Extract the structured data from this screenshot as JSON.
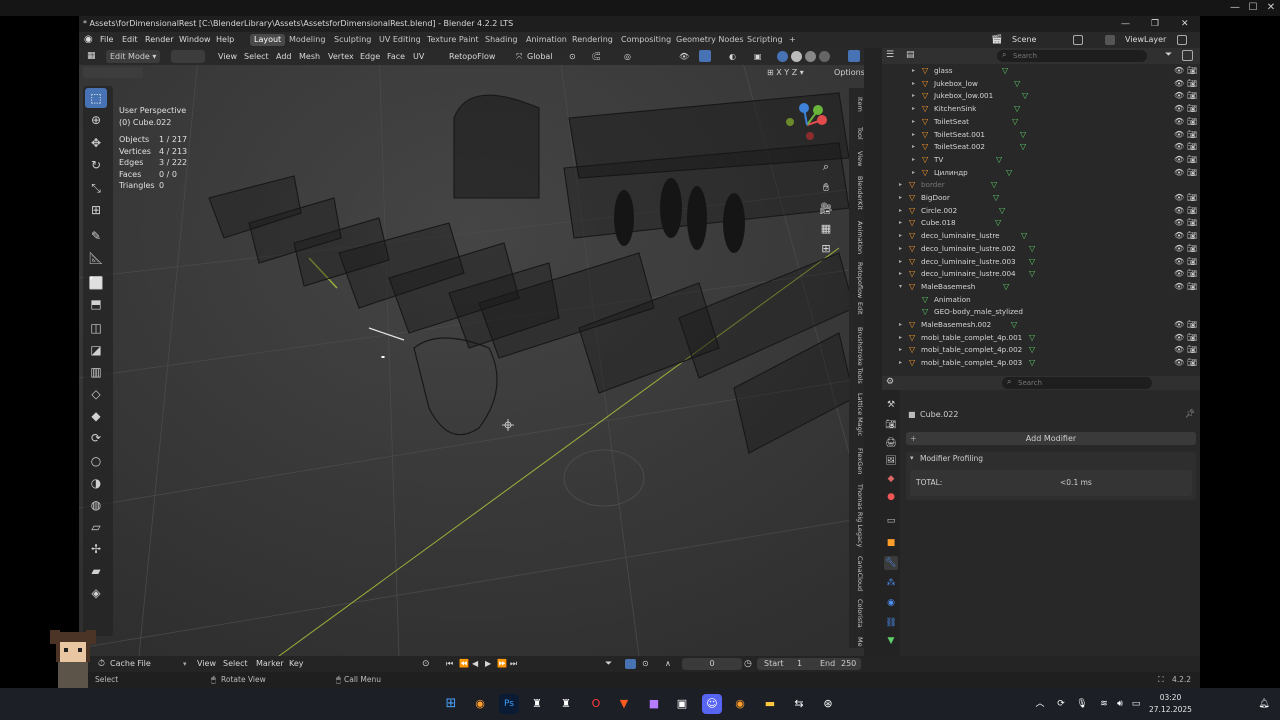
{
  "window": {
    "title": "* Assets\\forDimensionalRest [C:\\BlenderLibrary\\Assets\\AssetsforDimensionalRest.blend] - Blender 4.2.2 LTS"
  },
  "menus": [
    "File",
    "Edit",
    "Render",
    "Window",
    "Help"
  ],
  "workspaces": [
    {
      "label": "Layout",
      "active": true
    },
    {
      "label": "Modeling"
    },
    {
      "label": "Sculpting"
    },
    {
      "label": "UV Editing"
    },
    {
      "label": "Texture Paint"
    },
    {
      "label": "Shading"
    },
    {
      "label": "Animation"
    },
    {
      "label": "Rendering"
    },
    {
      "label": "Compositing"
    },
    {
      "label": "Geometry Nodes"
    },
    {
      "label": "Scripting"
    }
  ],
  "add_workspace": "+",
  "scene": {
    "icon": "scene-icon",
    "name": "Scene",
    "view_layer": "ViewLayer"
  },
  "viewport_header": {
    "mode": "Edit Mode",
    "menus": [
      "View",
      "Select",
      "Add",
      "Mesh",
      "Vertex",
      "Edge",
      "Face",
      "UV"
    ],
    "addon": "RetopoFlow",
    "orientation": "Global",
    "options": "Options"
  },
  "viewport": {
    "view_name": "User Perspective",
    "object": "(0) Cube.022",
    "stats": [
      {
        "label": "Objects",
        "value": "1 / 217"
      },
      {
        "label": "Vertices",
        "value": "4 / 213"
      },
      {
        "label": "Edges",
        "value": "3 / 222"
      },
      {
        "label": "Faces",
        "value": "0 / 0"
      },
      {
        "label": "Triangles",
        "value": "0"
      }
    ],
    "side_tabs": [
      "Item",
      "Tool",
      "View",
      "BlenderKit",
      "Animation",
      "Retopoflow",
      "Edit",
      "Brushstroke Tools",
      "Lattice Magic",
      "FlexGen",
      "Thomas Rig Legacy",
      "CanaCloud",
      "Colorista",
      "Me"
    ]
  },
  "tools": [
    "select-box-icon",
    "cursor-icon",
    "move-icon",
    "rotate-icon",
    "scale-icon",
    "transform-icon",
    "annotate-icon",
    "measure-icon",
    "add-cube-icon",
    "extrude-icon",
    "inset-icon",
    "bevel-icon",
    "loop-cut-icon",
    "knife-icon",
    "poly-build-icon",
    "spin-icon",
    "smooth-icon",
    "edge-slide-icon",
    "shrink-fatten-icon",
    "shear-icon",
    "rip-icon"
  ],
  "outliner": {
    "search_placeholder": "Search",
    "items": [
      {
        "name": "glass",
        "indent": 2
      },
      {
        "name": "Jukebox_low",
        "indent": 2
      },
      {
        "name": "Jukebox_low.001",
        "indent": 2
      },
      {
        "name": "KitchenSink",
        "indent": 2
      },
      {
        "name": "ToiletSeat",
        "indent": 2
      },
      {
        "name": "ToiletSeat.001",
        "indent": 2
      },
      {
        "name": "ToiletSeat.002",
        "indent": 2
      },
      {
        "name": "TV",
        "indent": 2
      },
      {
        "name": "Цилиндр",
        "indent": 2
      },
      {
        "name": "border",
        "indent": 1,
        "dim": true
      },
      {
        "name": "BigDoor",
        "indent": 1
      },
      {
        "name": "Circle.002",
        "indent": 1
      },
      {
        "name": "Cube.018",
        "indent": 1
      },
      {
        "name": "deco_luminaire_lustre",
        "indent": 1
      },
      {
        "name": "deco_luminaire_lustre.002",
        "indent": 1
      },
      {
        "name": "deco_luminaire_lustre.003",
        "indent": 1
      },
      {
        "name": "deco_luminaire_lustre.004",
        "indent": 1
      },
      {
        "name": "MaleBasemesh",
        "indent": 1,
        "open": true
      },
      {
        "name": "Animation",
        "indent": 2,
        "sub": true
      },
      {
        "name": "GEO-body_male_stylized",
        "indent": 2,
        "sub": true
      },
      {
        "name": "MaleBasemesh.002",
        "indent": 1
      },
      {
        "name": "mobi_table_complet_4p.001",
        "indent": 1
      },
      {
        "name": "mobi_table_complet_4p.002",
        "indent": 1
      },
      {
        "name": "mobi_table_complet_4p.003",
        "indent": 1
      }
    ]
  },
  "properties": {
    "search_placeholder": "Search",
    "object": "Cube.022",
    "add_modifier": "Add Modifier",
    "panel": "Modifier Profiling",
    "total_label": "TOTAL:",
    "total_value": "<0.1 ms"
  },
  "timeline": {
    "editor": "Cache File",
    "menus": [
      "View",
      "Select",
      "Marker",
      "Key"
    ],
    "frame": "0",
    "start_label": "Start",
    "start": "1",
    "end_label": "End",
    "end": "250"
  },
  "statusbar": {
    "select": "Select",
    "rotate": "Rotate View",
    "menu": "Call Menu",
    "version": "4.2.2"
  },
  "taskbar": {
    "time": "03:20",
    "date": "27.12.2025"
  },
  "colors": {
    "accent": "#4772b3",
    "orange": "#ff9d2b",
    "green": "#5fd06a",
    "grid_axis": "#9ab33a"
  }
}
